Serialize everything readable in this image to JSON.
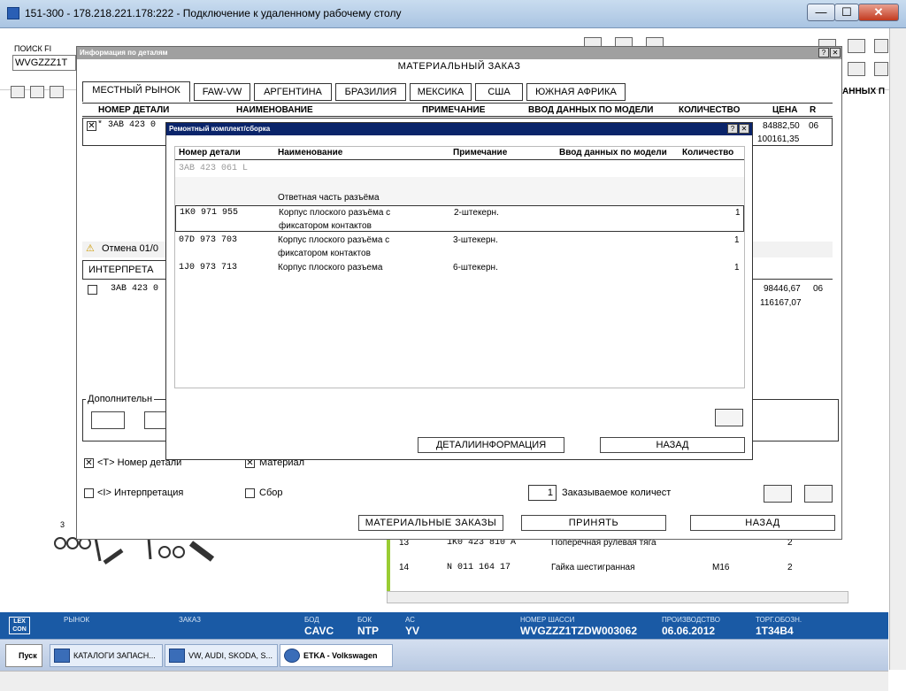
{
  "window": {
    "title": "151-300 - 178.218.221.178:222 - Подключение к удаленному рабочему столу",
    "minimize": "—",
    "maximize": "☐",
    "close": "✕"
  },
  "background": {
    "search_label": "ПОИСК FI",
    "search_value": "WVGZZZ1T",
    "right_col_header": "АННЫХ П",
    "parts": [
      {
        "num": "13",
        "part": "1K0  423  810  A",
        "name": "Поперечная рулевая тяга",
        "note": "",
        "qty": "2"
      },
      {
        "num": "14",
        "part": "N     011  164  17",
        "name": "Гайка шестигранная",
        "note": "M16",
        "qty": "2"
      }
    ],
    "illustration_label": "3"
  },
  "info_dialog": {
    "header": "Информация по деталям",
    "help": "?",
    "close": "✕",
    "title": "МАТЕРИАЛЬНЫЙ ЗАКАЗ",
    "tabs": [
      "МЕСТНЫЙ РЫНОК",
      "FAW-VW",
      "АРГЕНТИНА",
      "БРАЗИЛИЯ",
      "МЕКСИКА",
      "США",
      "ЮЖНАЯ АФРИКА"
    ],
    "columns": {
      "part": "НОМЕР ДЕТАЛИ",
      "name": "НАИМЕНОВАНИЕ",
      "note": "ПРИМЕЧАНИЕ",
      "model": "ВВОД ДАННЫХ ПО МОДЕЛИ",
      "qty": "КОЛИЧЕСТВО",
      "price": "ЦЕНА",
      "r": "R"
    },
    "row1": {
      "check": "✕",
      "part": "* 3АВ  423  0",
      "price1": "84882,50",
      "price2": "100161,35",
      "r": "06"
    },
    "cancel_text": "Отмена 01/0",
    "interp_tab": "ИНТЕРПРЕТА",
    "row2": {
      "part": "3АВ  423  0",
      "price1": "98446,67",
      "price2": "116167,07",
      "r": "06"
    },
    "additional_label": "Дополнительн",
    "opt_part_number": "<Т> Номер детали",
    "opt_material": "Материал",
    "opt_interpretation": "<I> Интерпретация",
    "opt_assembly": "Сбор",
    "order_qty_value": "1",
    "order_qty_label": "Заказываемое количест",
    "btn_material_orders": "МАТЕРИАЛЬНЫЕ ЗАКАЗЫ",
    "btn_accept": "ПРИНЯТЬ",
    "btn_back": "НАЗАД"
  },
  "kit_dialog": {
    "header": "Ремонтный комплект/сборка",
    "help": "?",
    "close": "✕",
    "columns": {
      "part": "Номер детали",
      "name": "Наименование",
      "note": "Примечание",
      "model": "Ввод данных по модели",
      "qty": "Количество"
    },
    "parent_part": "3AB  423  061  L",
    "group_label": "Ответная часть разъёма",
    "rows": [
      {
        "part": "1K0  971  955",
        "name1": "Корпус плоского разъёма с",
        "name2": "фиксатором контактов",
        "note": "2-штекерн.",
        "qty": "1"
      },
      {
        "part": "07D  973  703",
        "name1": "Корпус плоского разъёма с",
        "name2": "фиксатором контактов",
        "note": "3-штекерн.",
        "qty": "1"
      },
      {
        "part": "1J0  973  713",
        "name1": "Корпус плоского разъема",
        "name2": "",
        "note": "6-штекерн.",
        "qty": "1"
      }
    ],
    "btn_details": "ДЕТАЛИИНФОРМАЦИЯ",
    "btn_back": "НАЗАД"
  },
  "status_bar": {
    "logo": "LEX CON",
    "market_label": "РЫНОК",
    "order_label": "ЗАКАЗ",
    "bod_label": "БОД",
    "bod_value": "CAVC",
    "bok_label": "БОК",
    "bok_value": "NTP",
    "ac_label": "АС",
    "ac_value": "YV",
    "chassis_label": "НОМЕР ШАССИ",
    "chassis_value": "WVGZZZ1TZDW003062",
    "production_label": "ПРОИЗВОДСТВО",
    "production_value": "06.06.2012",
    "trade_label": "ТОРГ.ОБОЗН.",
    "trade_value": "1T34B4"
  },
  "taskbar": {
    "start": "Пуск",
    "items": [
      "КАТАЛОГИ ЗАПАСН...",
      "VW, AUDI, SKODA, S...",
      "ETKA - Volkswagen"
    ]
  }
}
